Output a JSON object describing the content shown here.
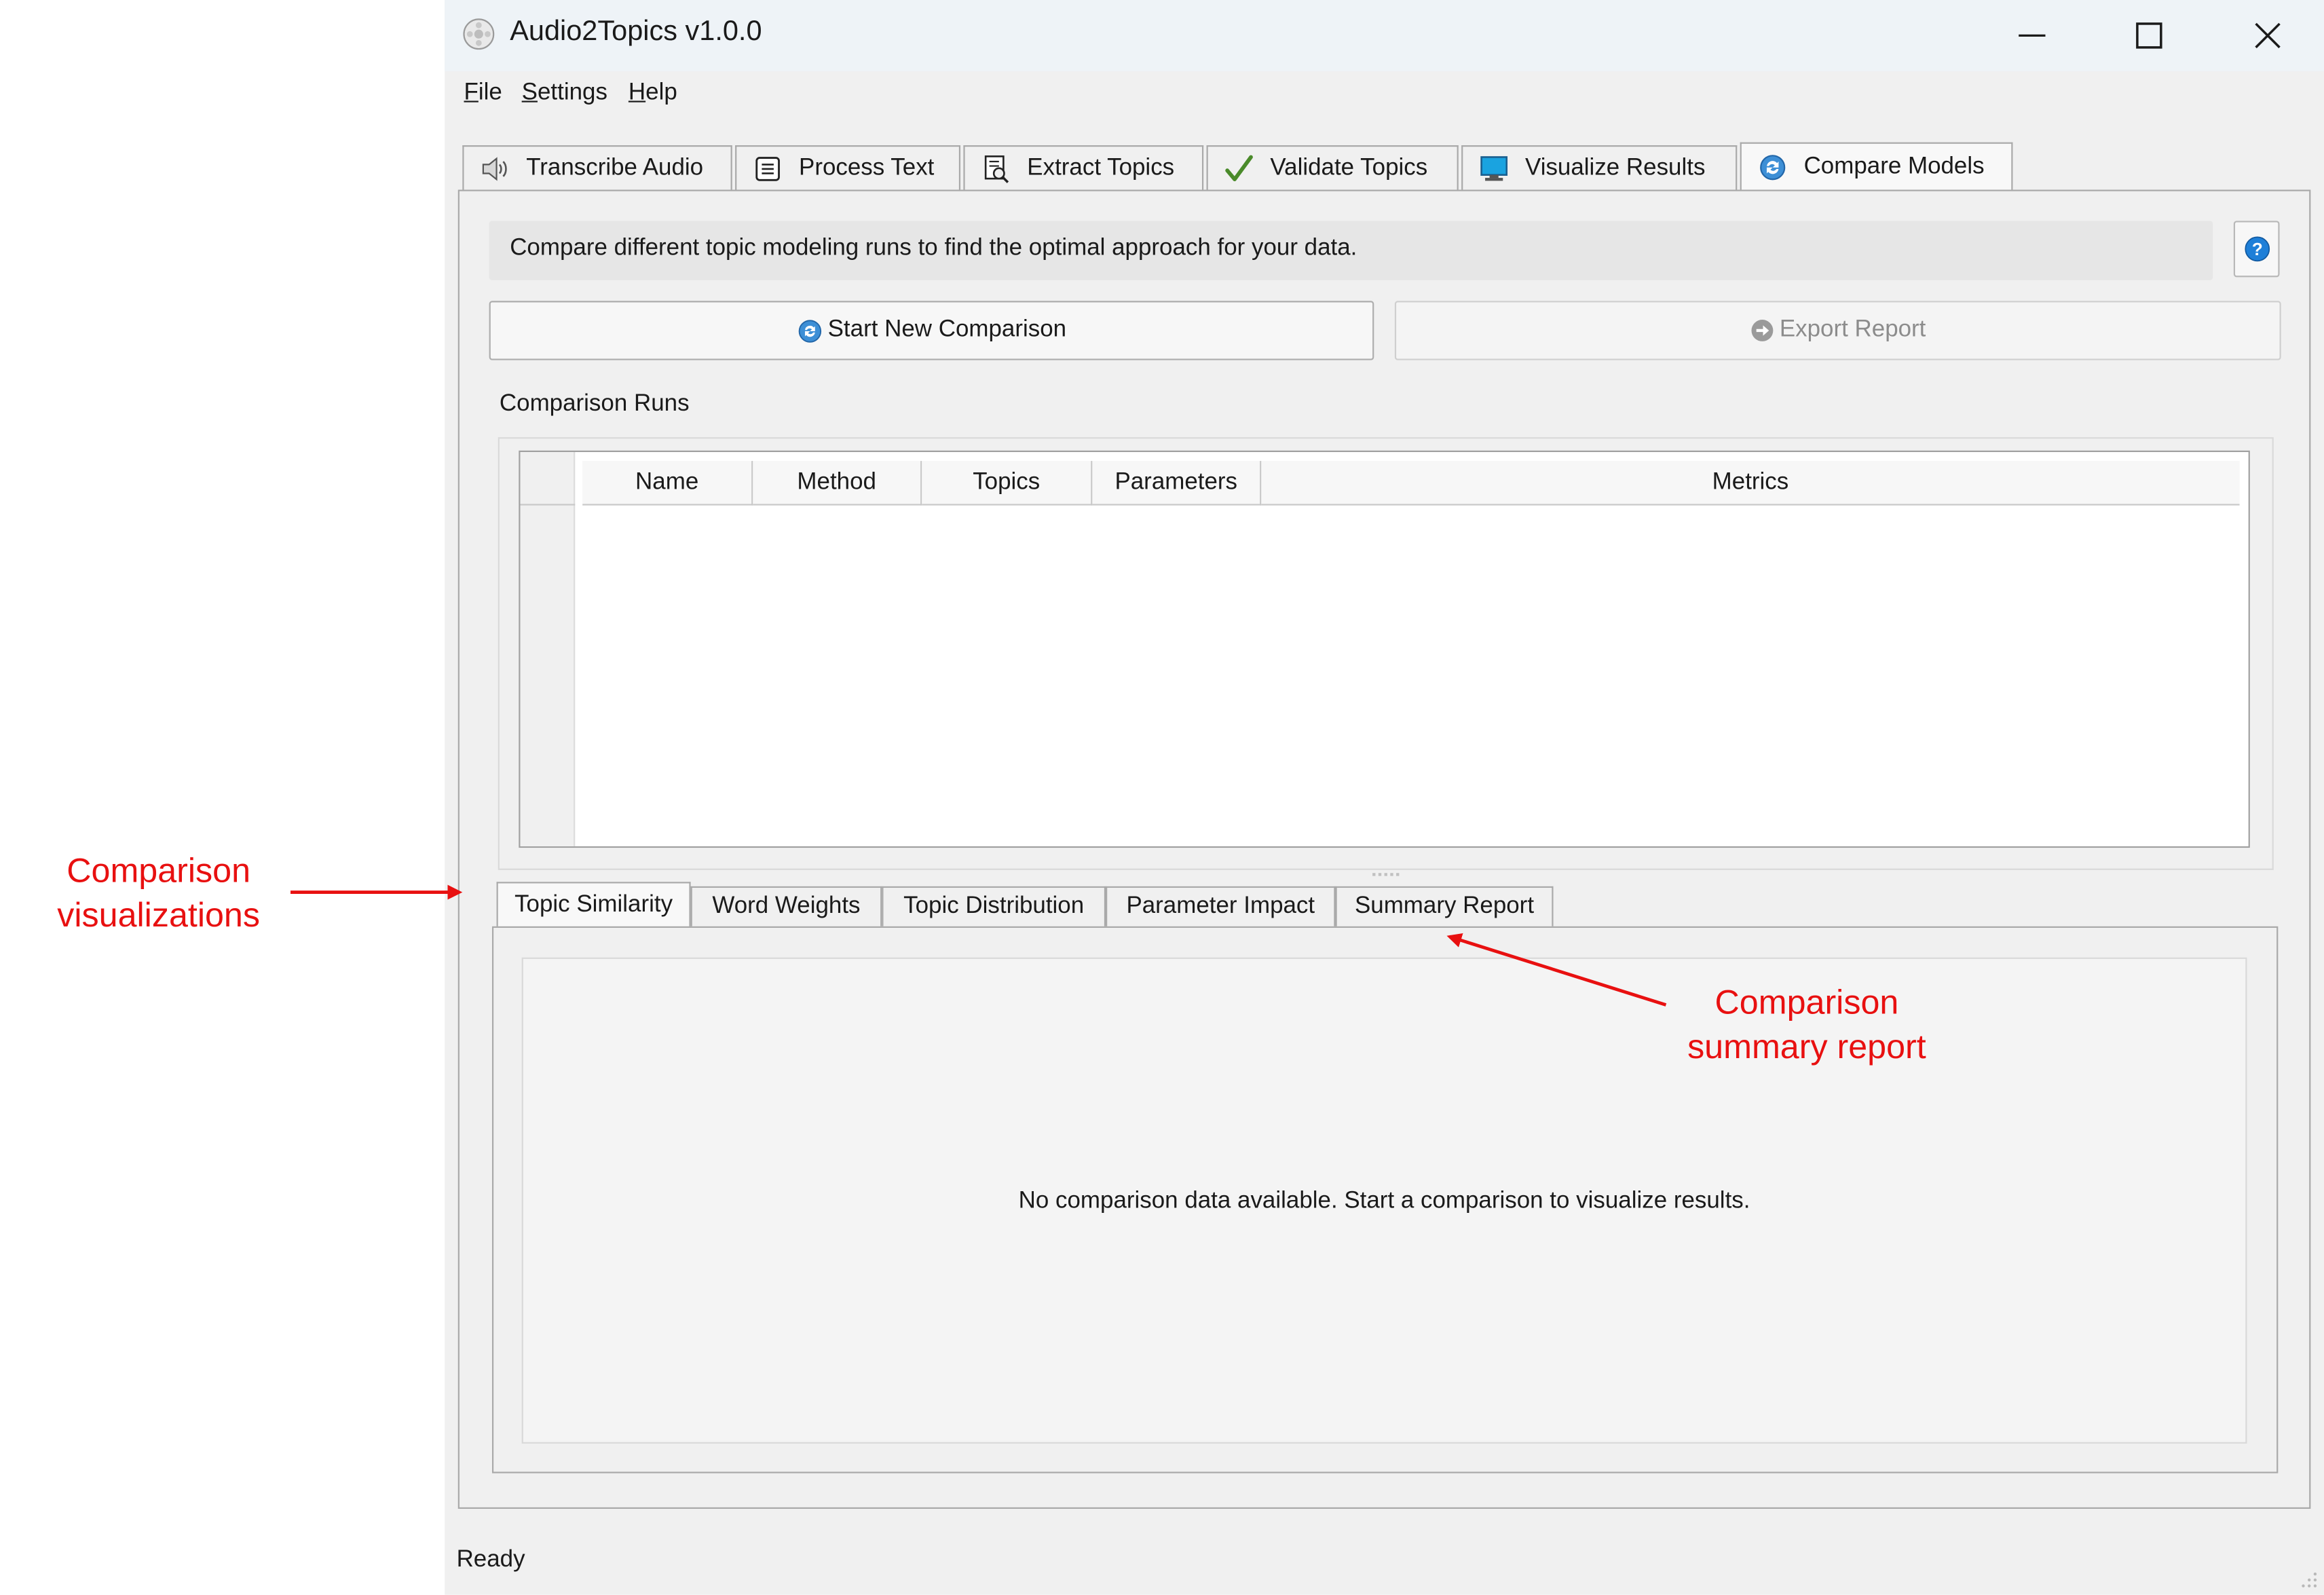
{
  "window": {
    "title": "Audio2Topics v1.0.0"
  },
  "menubar": {
    "items": [
      {
        "label": "File",
        "mnemonic": "F",
        "rest": "ile"
      },
      {
        "label": "Settings",
        "mnemonic": "S",
        "rest": "ettings"
      },
      {
        "label": "Help",
        "mnemonic": "H",
        "rest": "elp"
      }
    ]
  },
  "tabs": [
    {
      "label": "Transcribe Audio",
      "icon": "speaker-icon"
    },
    {
      "label": "Process Text",
      "icon": "document-icon"
    },
    {
      "label": "Extract Topics",
      "icon": "search-document-icon"
    },
    {
      "label": "Validate Topics",
      "icon": "checkmark-icon"
    },
    {
      "label": "Visualize Results",
      "icon": "monitor-icon"
    },
    {
      "label": "Compare Models",
      "icon": "refresh-icon",
      "active": true
    }
  ],
  "compare": {
    "info": "Compare different topic modeling runs to find the optimal approach for your data.",
    "start_button": "Start New Comparison",
    "export_button": "Export Report",
    "runs_label": "Comparison Runs",
    "columns": [
      "Name",
      "Method",
      "Topics",
      "Parameters",
      "Metrics"
    ],
    "subtabs": [
      "Topic Similarity",
      "Word Weights",
      "Topic Distribution",
      "Parameter Impact",
      "Summary Report"
    ],
    "active_subtab": "Topic Similarity",
    "empty_message": "No comparison data available. Start a comparison to visualize results."
  },
  "status": {
    "text": "Ready"
  },
  "annotations": {
    "left": "Comparison\nvisualizations",
    "right": "Comparison\nsummary report"
  },
  "colors": {
    "annotation": "#e81010",
    "help_blue": "#1e7fd8"
  }
}
